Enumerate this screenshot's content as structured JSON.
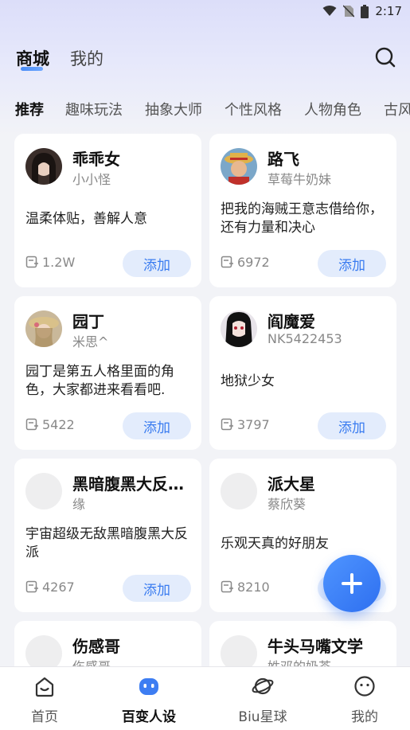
{
  "status": {
    "time": "2:17"
  },
  "header": {
    "tabs": [
      {
        "label": "商城"
      },
      {
        "label": "我的"
      }
    ]
  },
  "categories": [
    "推荐",
    "趣味玩法",
    "抽象大师",
    "个性风格",
    "人物角色",
    "古风"
  ],
  "cards": [
    {
      "name": "乖乖女",
      "author": "小小怪",
      "desc": "温柔体贴，善解人意",
      "count": "1.2W",
      "add": "添加"
    },
    {
      "name": "路飞",
      "author": "草莓牛奶妹",
      "desc": "把我的海贼王意志借给你，还有力量和决心",
      "count": "6972",
      "add": "添加"
    },
    {
      "name": "园丁",
      "author": "米思^",
      "desc": "园丁是第五人格里面的角色，大家都进来看看吧.",
      "count": "5422",
      "add": "添加"
    },
    {
      "name": "阎魔爱",
      "author": "NK5422453",
      "desc": "地狱少女",
      "count": "3797",
      "add": "添加"
    },
    {
      "name": "黑暗腹黑大反…",
      "author": "缘",
      "desc": "宇宙超级无敌黑暗腹黑大反派",
      "count": "4267",
      "add": "添加"
    },
    {
      "name": "派大星",
      "author": "蔡欣葵",
      "desc": "乐观天真的好朋友",
      "count": "8210",
      "add": "添加"
    },
    {
      "name": "伤感哥",
      "author": "伤感哥"
    },
    {
      "name": "牛头马嘴文学",
      "author": "姓邓的奶茶"
    }
  ],
  "nav": [
    {
      "label": "首页"
    },
    {
      "label": "百变人设"
    },
    {
      "label": "Biu星球"
    },
    {
      "label": "我的"
    }
  ],
  "colors": {
    "accent": "#3a7cf0",
    "add_bg": "#e3ecfc",
    "fab": "#3b7ff5"
  }
}
